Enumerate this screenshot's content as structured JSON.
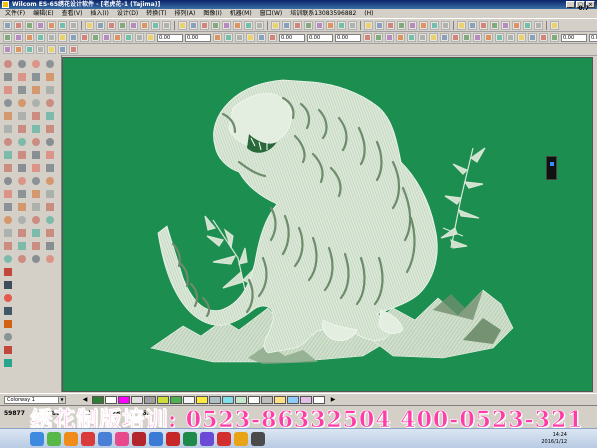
{
  "window": {
    "title": "Wilcom ES-65绣花设计软件 - [老虎花-1 (Tajima)]",
    "controls": [
      "_",
      "□",
      "×"
    ]
  },
  "menu": {
    "items": [
      "文件(F)",
      "编辑(E)",
      "查看(V)",
      "插入(I)",
      "设计(D)",
      "转换(T)",
      "排列(A)",
      "图像(I)",
      "机器(M)",
      "窗口(W)",
      "培训联系13083596882",
      "(H)"
    ]
  },
  "toolbars": {
    "field1": "0.00",
    "field2": "0.00",
    "field3": "0.00",
    "field4": "0.00",
    "field5": "0.00",
    "field6": "0.00",
    "field7": "0.00"
  },
  "canvas": {
    "background_color": "#1c8e4f",
    "thread_color": "#d8e6d6"
  },
  "colorway": {
    "label": "Colorway 1",
    "swatches": [
      {
        "color": "#2e7d32",
        "label": ""
      },
      {
        "color": "#ffffff",
        "label": ""
      },
      {
        "color": "#ff00ff",
        "label": ""
      },
      {
        "color": "#e0e0e0",
        "label": ""
      },
      {
        "color": "#9e9e9e",
        "label": ""
      },
      {
        "color": "#cddc39",
        "label": ""
      },
      {
        "color": "#4caf50",
        "label": ""
      },
      {
        "color": "#f5f5f5",
        "label": ""
      },
      {
        "color": "#ffeb3b",
        "label": ""
      },
      {
        "color": "#b0bec5",
        "label": ""
      },
      {
        "color": "#80deea",
        "label": ""
      },
      {
        "color": "#c8e6c9",
        "label": ""
      },
      {
        "color": "#ffffff",
        "label": ""
      },
      {
        "color": "#bdbdbd",
        "label": ""
      },
      {
        "color": "#ffe082",
        "label": ""
      },
      {
        "color": "#90caf9",
        "label": ""
      },
      {
        "color": "#e1bee7",
        "label": ""
      },
      {
        "color": "#ffffff",
        "label": ""
      }
    ]
  },
  "status": {
    "stitches": "59877",
    "x": "-2.80",
    "y": "-5.2",
    "len": "-28",
    "w": "66.",
    "right": "0.7"
  },
  "promo": {
    "text": "绣花制版培训: 0523-86332504 400-0523-321"
  },
  "taskbar": {
    "time": "14:24",
    "date": "2016/1/12",
    "icon_colors": [
      "#3d8ae0",
      "#57b847",
      "#f08c1c",
      "#d93a3a",
      "#4a7fd6",
      "#e64a8d",
      "#b3262e",
      "#3a7bd5",
      "#c62828",
      "#1f8a4c",
      "#6b4bd6",
      "#d32f2f",
      "#e8a317",
      "#4b4b4b"
    ]
  }
}
